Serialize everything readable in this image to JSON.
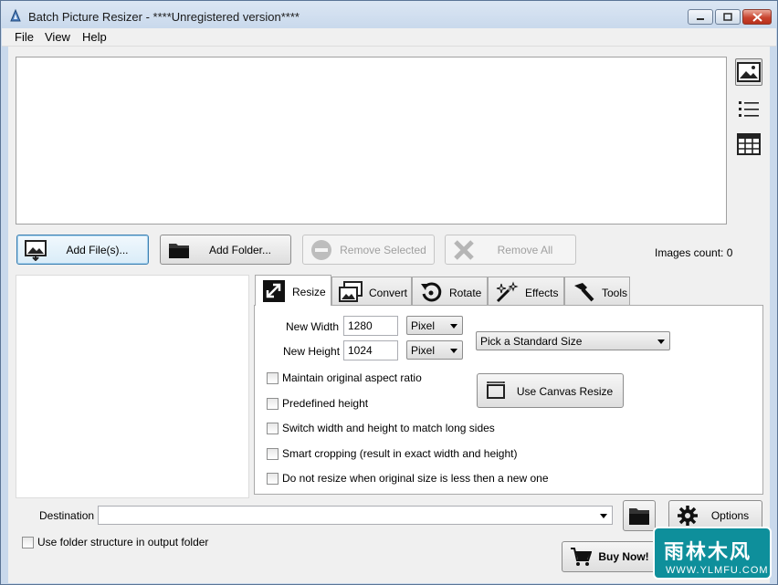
{
  "window": {
    "title": "Batch Picture Resizer - ****Unregistered version****"
  },
  "menu": {
    "file": "File",
    "view": "View",
    "help": "Help"
  },
  "toolbar": {
    "add_files": "Add File(s)...",
    "add_folder": "Add Folder...",
    "remove_selected": "Remove Selected",
    "remove_all": "Remove All",
    "images_count": "Images count: 0"
  },
  "tabs": {
    "resize": "Resize",
    "convert": "Convert",
    "rotate": "Rotate",
    "effects": "Effects",
    "tools": "Tools"
  },
  "resize": {
    "new_width_label": "New Width",
    "new_width_value": "1280",
    "width_unit": "Pixel",
    "new_height_label": "New Height",
    "new_height_value": "1024",
    "height_unit": "Pixel",
    "standard_size": "Pick a Standard Size",
    "canvas_resize": "Use Canvas Resize",
    "options": [
      "Maintain original aspect ratio",
      "Predefined height",
      "Switch width and height to match long sides",
      "Smart cropping (result in exact width and height)",
      "Do not resize when original size is less then a new one"
    ]
  },
  "bottom": {
    "destination_label": "Destination",
    "destination_value": "",
    "options_label": "Options",
    "buy_now": "Buy Now!",
    "folder_structure": "Use folder structure in output folder"
  },
  "watermark": {
    "line1": "雨林木风",
    "line2": "WWW.YLMFU.COM"
  }
}
